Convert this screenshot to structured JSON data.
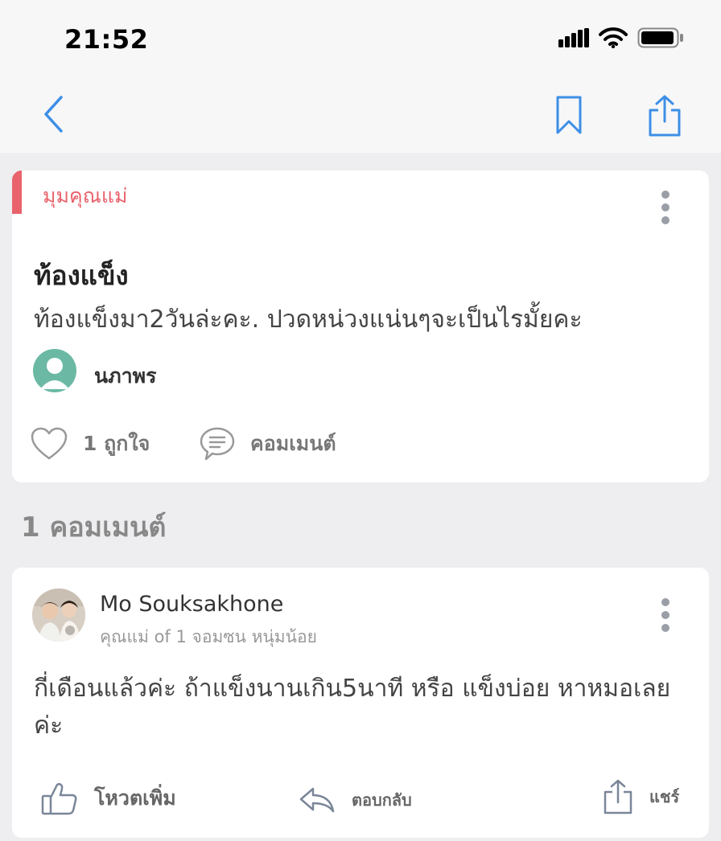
{
  "status": {
    "time": "21:52"
  },
  "post": {
    "category": "มุมคุณแม่",
    "title": "ท้องแข็ง",
    "body": "ท้องแข็งมา2วันล่ะคะ. ปวดหน่วงแน่นๆจะเป็นไรมั้ยคะ",
    "author": "นภาพร",
    "like_label": "1 ถูกใจ",
    "comment_label": "คอมเมนต์"
  },
  "comments_section": {
    "title": "1 คอมเมนต์"
  },
  "comment": {
    "name": "Mo Souksakhone",
    "meta": "คุณแม่ of 1 จอมซน หนุ่มน้อย",
    "body": "กี่เดือนแล้วค่ะ ถ้าแข็งนานเกิน5นาที หรือ แข็งบ่อย หาหมอเลยค่ะ",
    "vote_label": "โหวตเพิ่ม",
    "reply_label": "ตอบกลับ",
    "share_label": "แชร์"
  },
  "colors": {
    "accent": "#3d8fe6",
    "category": "#e8636c",
    "avatar": "#6bb9a4"
  },
  "icons": [
    "signal-icon",
    "wifi-icon",
    "battery-icon",
    "back-icon",
    "bookmark-icon",
    "share-icon",
    "more-icon",
    "heart-icon",
    "comment-icon",
    "thumbs-up-icon",
    "reply-icon"
  ]
}
